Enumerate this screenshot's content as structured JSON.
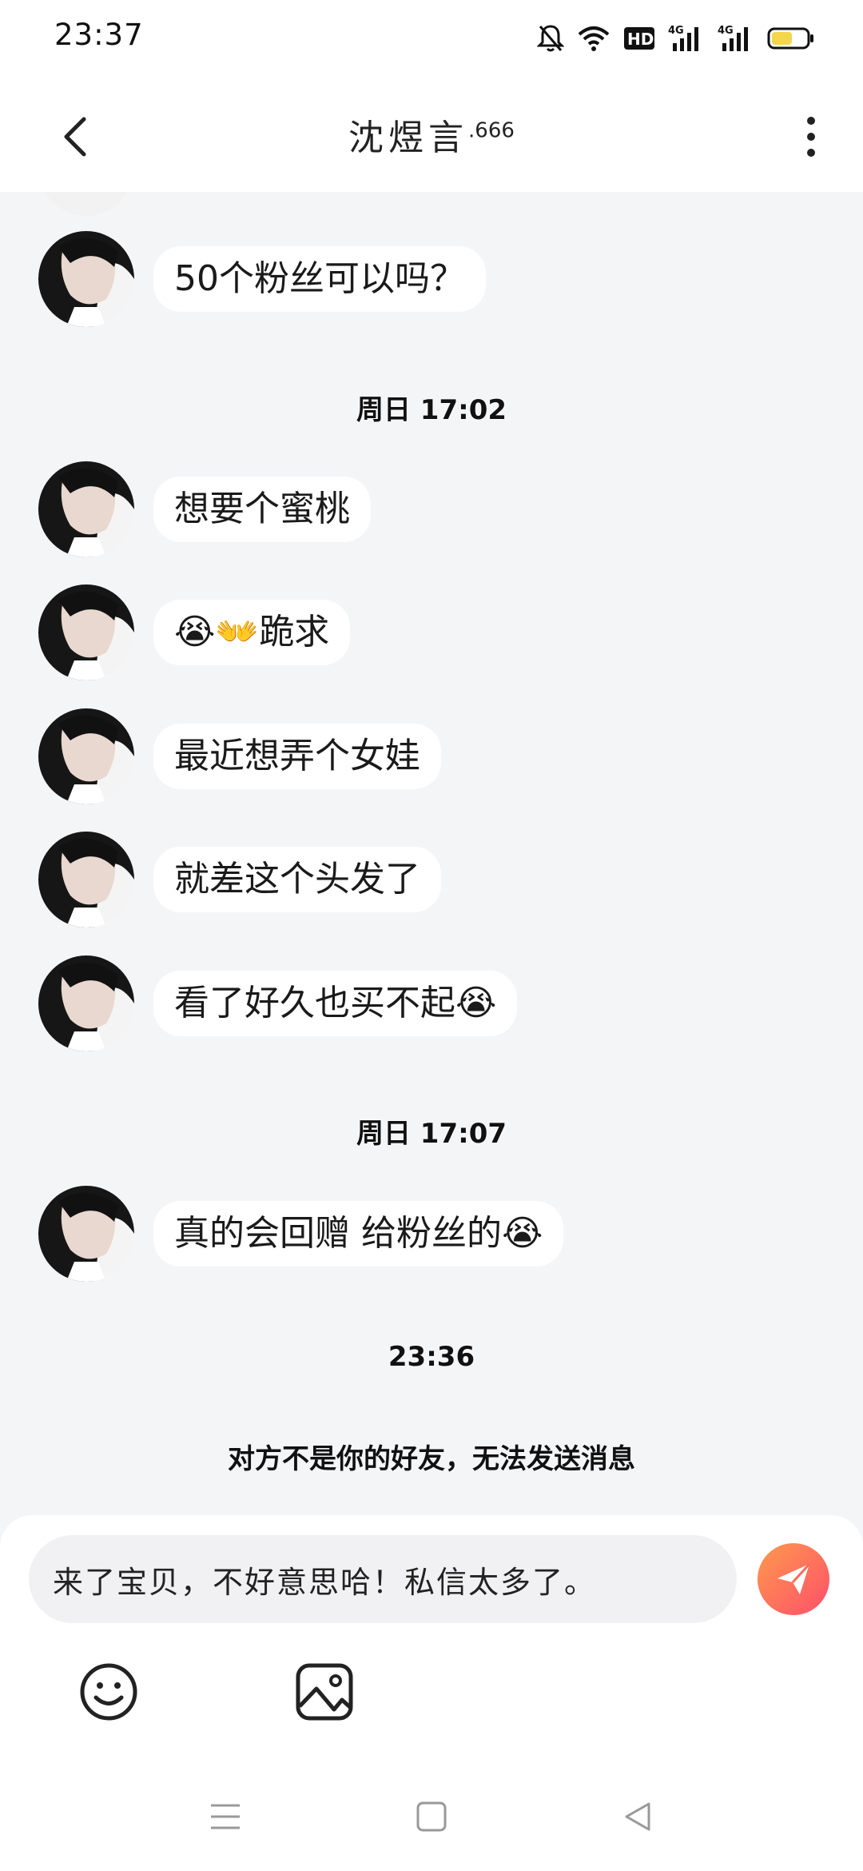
{
  "status_bar": {
    "time": "23:37",
    "icons": [
      "bell-off-icon",
      "wifi-icon",
      "hd-icon",
      "signal-4g-icon",
      "signal-4g-icon",
      "battery-icon"
    ],
    "hd_label": "HD",
    "net_label": "4G"
  },
  "header": {
    "title": "沈煜言",
    "title_suffix": ".666"
  },
  "messages": [
    {
      "type": "message",
      "text": "50个粉丝可以吗？"
    },
    {
      "type": "timestamp",
      "text": "周日 17:02"
    },
    {
      "type": "message",
      "text": "想要个蜜桃"
    },
    {
      "type": "message",
      "text": "😭👐跪求"
    },
    {
      "type": "message",
      "text": "最近想弄个女娃"
    },
    {
      "type": "message",
      "text": "就差这个头发了"
    },
    {
      "type": "message",
      "text": "看了好久也买不起😭"
    },
    {
      "type": "timestamp",
      "text": "周日 17:07"
    },
    {
      "type": "message",
      "text": "真的会回赠  给粉丝的😭"
    },
    {
      "type": "timestamp",
      "text": "23:36"
    },
    {
      "type": "notice",
      "text": "对方不是你的好友，无法发送消息"
    }
  ],
  "input": {
    "value": "来了宝贝，不好意思哈！私信太多了。"
  },
  "colors": {
    "background": "#f4f5f7",
    "bubble": "#ffffff",
    "send_gradient_start": "#ff9a4d",
    "send_gradient_end": "#ff4f6a"
  }
}
